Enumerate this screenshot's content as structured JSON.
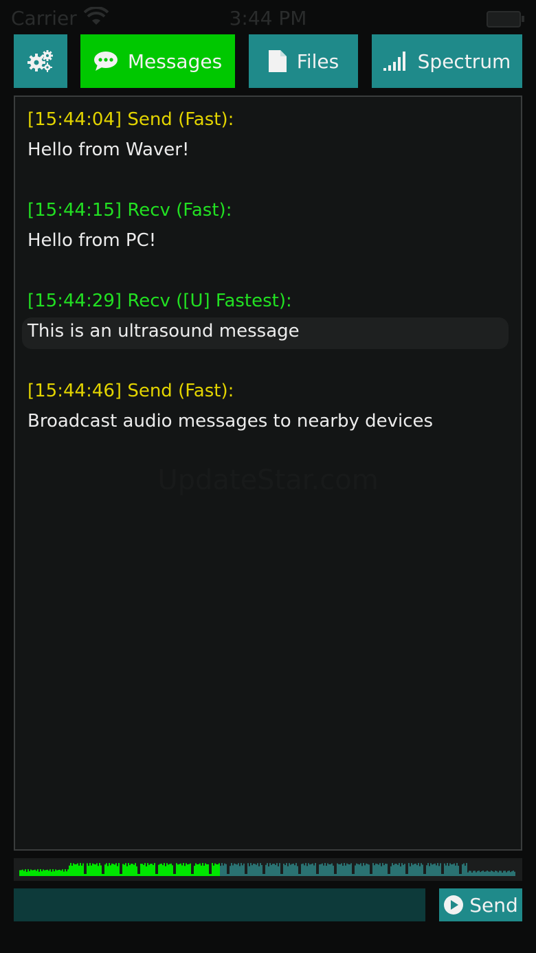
{
  "status_bar": {
    "carrier": "Carrier",
    "time": "3:44 PM"
  },
  "tabs": [
    {
      "label": "",
      "icon": "gears-icon",
      "active": false
    },
    {
      "label": "Messages",
      "icon": "chat-bubble-icon",
      "active": true
    },
    {
      "label": "Files",
      "icon": "file-icon",
      "active": false
    },
    {
      "label": "Spectrum",
      "icon": "signal-bars-icon",
      "active": false
    }
  ],
  "messages": [
    {
      "header": "[15:44:04] Send (Fast):",
      "body": "Hello from Waver!",
      "direction": "send"
    },
    {
      "header": "[15:44:15] Recv (Fast):",
      "body": "Hello from PC!",
      "direction": "recv"
    },
    {
      "header": "[15:44:29] Recv ([U] Fastest):",
      "body": "This is an ultrasound message",
      "direction": "recv"
    },
    {
      "header": "[15:44:46] Send (Fast):",
      "body": "Broadcast audio messages to nearby devices",
      "direction": "send"
    }
  ],
  "watermark": "UpdateStar.com",
  "input": {
    "value": "",
    "placeholder": ""
  },
  "send_button": {
    "label": "Send",
    "icon": "play-circle-icon"
  },
  "waveform": {
    "progress": 0.405
  },
  "colors": {
    "tab": "#1f8a8a",
    "tab_active": "#00c800",
    "send_header": "#e3d400",
    "recv_header": "#22e022",
    "waveform_played": "#00e600",
    "waveform_pending": "#2a7272"
  }
}
